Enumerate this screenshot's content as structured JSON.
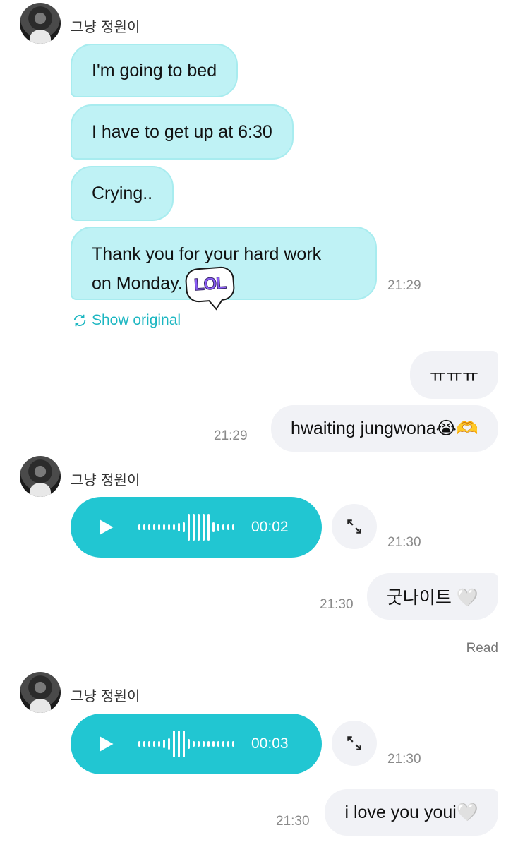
{
  "sender_name": "그냥 정원이",
  "messages_in_1": [
    "I'm going to bed",
    "I have to get up at 6:30",
    "Crying..",
    "Thank you for your hard work"
  ],
  "msg4_line2": "on Monday.",
  "sticker_text": "LOL",
  "time_2129": "21:29",
  "show_original": "Show original",
  "out_1": "ㅠㅠㅠ",
  "out_2": "hwaiting jungwona😭🫶",
  "time_2130": "21:30",
  "voice_1_duration": "00:02",
  "out_3": "굿나이트 🤍",
  "read_label": "Read",
  "voice_2_duration": "00:03",
  "out_4": "i love you youi🤍",
  "colors": {
    "incoming_bubble": "#bff2f5",
    "outgoing_bubble": "#f1f2f6",
    "voice_bubble": "#21c6d2",
    "accent": "#1bb6c1"
  },
  "icons": [
    "avatar",
    "play-icon",
    "expand-icon",
    "translate-icon",
    "lol-sticker"
  ]
}
